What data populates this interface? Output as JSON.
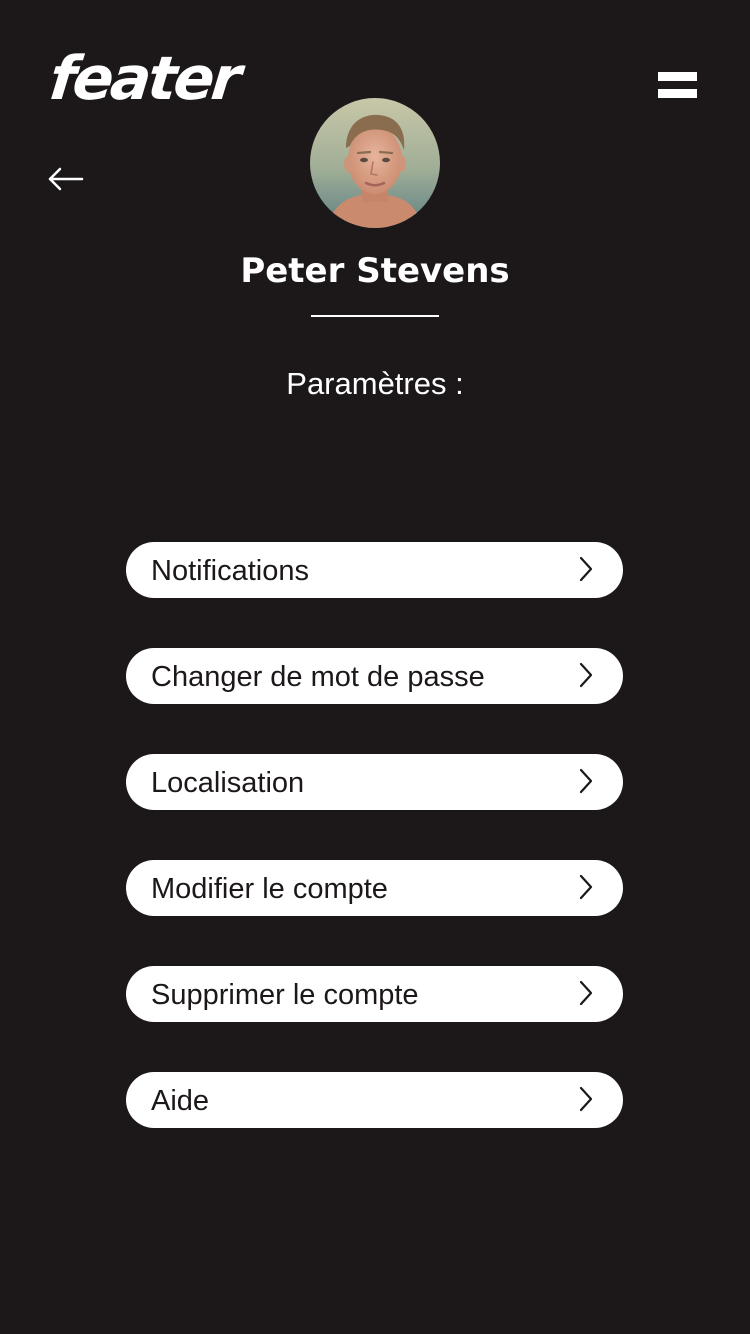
{
  "header": {
    "logo_text": "feater",
    "menu_icon": "hamburger-menu-icon",
    "back_icon": "arrow-left-icon"
  },
  "profile": {
    "name": "Peter Stevens",
    "avatar": "profile-photo"
  },
  "settings": {
    "title": "Paramètres :",
    "items": [
      {
        "label": "Notifications",
        "icon": "chevron-right-icon"
      },
      {
        "label": "Changer de mot de passe",
        "icon": "chevron-right-icon"
      },
      {
        "label": "Localisation",
        "icon": "chevron-right-icon"
      },
      {
        "label": "Modifier le compte",
        "icon": "chevron-right-icon"
      },
      {
        "label": "Supprimer le compte",
        "icon": "chevron-right-icon"
      },
      {
        "label": "Aide",
        "icon": "chevron-right-icon"
      }
    ]
  },
  "colors": {
    "background": "#1c1819",
    "foreground": "#ffffff",
    "button_text": "#1c1819"
  }
}
